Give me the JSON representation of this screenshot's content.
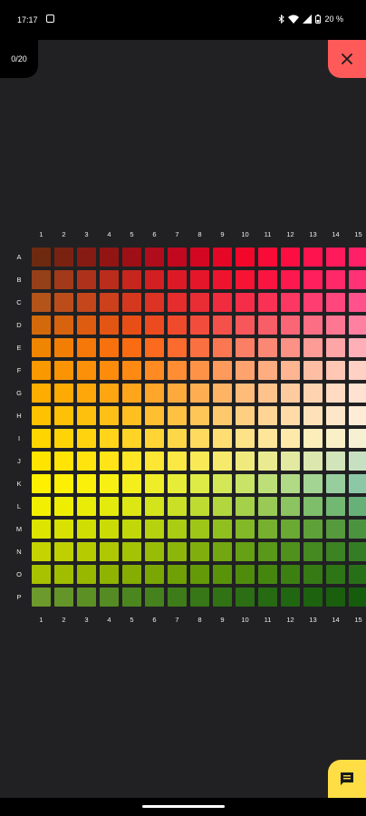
{
  "status_bar": {
    "time": "17:17",
    "battery_text": "20 %"
  },
  "counter": {
    "text": "0/20"
  },
  "icons": {
    "close": "close-icon",
    "chat": "chat-icon"
  },
  "colors": {
    "background": "#212123",
    "close_button": "#ff5a5a",
    "chat_button": "#ffdd44"
  },
  "grid": {
    "column_labels": [
      "1",
      "2",
      "3",
      "4",
      "5",
      "6",
      "7",
      "8",
      "9",
      "10",
      "11",
      "12",
      "13",
      "14",
      "15"
    ],
    "row_labels": [
      "A",
      "B",
      "C",
      "D",
      "E",
      "F",
      "G",
      "H",
      "I",
      "J",
      "K",
      "L",
      "M",
      "N",
      "O",
      "P"
    ],
    "rows": [
      [
        "#6e2a10",
        "#7a2212",
        "#861b13",
        "#921514",
        "#9e1016",
        "#b00c1c",
        "#c2081f",
        "#d40723",
        "#e60626",
        "#f2072b",
        "#f80b36",
        "#fc0e42",
        "#ff134f",
        "#ff1a5c",
        "#ff2068"
      ],
      [
        "#964019",
        "#a2391a",
        "#ae321b",
        "#ba2c1c",
        "#c6261e",
        "#d21f22",
        "#dc1a26",
        "#e6162a",
        "#ef142e",
        "#f61334",
        "#fa1540",
        "#fd184d",
        "#ff1f5b",
        "#ff2868",
        "#ff3276"
      ],
      [
        "#b4541a",
        "#bc4d1a",
        "#c4461a",
        "#cc401c",
        "#d4391f",
        "#dc3325",
        "#e42d2c",
        "#ea2c35",
        "#f02c3e",
        "#f52d49",
        "#f93155",
        "#fc3762",
        "#ff3e6f",
        "#ff477d",
        "#ff518b"
      ],
      [
        "#d26a0c",
        "#d8630e",
        "#de5c10",
        "#e35513",
        "#e84f17",
        "#ec4b20",
        "#f04a2d",
        "#f24d3c",
        "#f4514b",
        "#f6575a",
        "#f85e68",
        "#fa6676",
        "#fc6e84",
        "#fe7792",
        "#ff80a0"
      ],
      [
        "#ef8500",
        "#f27f04",
        "#f57808",
        "#f8710c",
        "#fa6c12",
        "#fb6a1e",
        "#fb6b2e",
        "#fb7040",
        "#fb7752",
        "#fb7f64",
        "#fb8875",
        "#fc9186",
        "#fd9b97",
        "#fea5a8",
        "#ffafb8"
      ],
      [
        "#fa9800",
        "#fb9404",
        "#fc9008",
        "#fd8c0d",
        "#fe8a14",
        "#fe8a22",
        "#fe8d34",
        "#fe9347",
        "#fe9a5b",
        "#fea36e",
        "#feac80",
        "#feb592",
        "#febea3",
        "#ffc7b4",
        "#ffd0c4"
      ],
      [
        "#fdad00",
        "#fdaa05",
        "#fea70b",
        "#fea512",
        "#fea51c",
        "#fea62a",
        "#fea93c",
        "#feae50",
        "#feb465",
        "#febb79",
        "#fec38c",
        "#fecb9e",
        "#fed3b0",
        "#fedbc1",
        "#ffe2d1"
      ],
      [
        "#fec200",
        "#fec106",
        "#fec00d",
        "#febf16",
        "#febf21",
        "#febf30",
        "#fec142",
        "#fec557",
        "#fec96c",
        "#fecf81",
        "#fed595",
        "#fedba7",
        "#fee1b8",
        "#fee7c8",
        "#ffecd6"
      ],
      [
        "#ffd500",
        "#ffd407",
        "#ffd40f",
        "#ffd41a",
        "#ffd427",
        "#ffd536",
        "#fed749",
        "#feda5e",
        "#fede73",
        "#fee287",
        "#fde69a",
        "#fdeaab",
        "#fceebb",
        "#f9f0c8",
        "#f5f1d2"
      ],
      [
        "#ffe400",
        "#ffe406",
        "#ffe40d",
        "#ffe418",
        "#fee525",
        "#fde634",
        "#fce845",
        "#f9e957",
        "#f5ea6b",
        "#f0ea7e",
        "#eaea90",
        "#e3e9a0",
        "#dbe7ae",
        "#d2e4b9",
        "#c8e0c2"
      ],
      [
        "#fff000",
        "#fdf004",
        "#fbf00a",
        "#f8f012",
        "#f4ef1c",
        "#eeee28",
        "#e7ec36",
        "#deea46",
        "#d4e756",
        "#c9e367",
        "#bddf77",
        "#b1da86",
        "#a4d493",
        "#98ce9e",
        "#8cc8a6"
      ],
      [
        "#f2f000",
        "#eeee02",
        "#e9ec06",
        "#e3ea0c",
        "#dce713",
        "#d3e41c",
        "#c9e026",
        "#bedb31",
        "#b2d63d",
        "#a5d049",
        "#98ca55",
        "#8bc460",
        "#7ebd6a",
        "#72b772",
        "#67b078"
      ],
      [
        "#dde400",
        "#d8e101",
        "#d1de03",
        "#cadb06",
        "#c1d70a",
        "#b6d20e",
        "#aacc13",
        "#9dc619",
        "#90bf20",
        "#83b827",
        "#76b02e",
        "#6aa934",
        "#5fa139",
        "#559a3d",
        "#4c9340"
      ],
      [
        "#c5d400",
        "#bed000",
        "#b6cc01",
        "#aec803",
        "#a4c305",
        "#99bd07",
        "#8db60a",
        "#80af0d",
        "#73a711",
        "#66a015",
        "#5a9819",
        "#4f911d",
        "#458a20",
        "#3c8323",
        "#357d25"
      ],
      [
        "#a9c200",
        "#a1bd00",
        "#98b800",
        "#8fb301",
        "#85ad02",
        "#7aa704",
        "#6fa005",
        "#649a07",
        "#59930a",
        "#4f8c0c",
        "#45860f",
        "#3c8011",
        "#357a14",
        "#2e7516",
        "#287018"
      ],
      [
        "#6c9a2c",
        "#649528",
        "#5c9025",
        "#548b22",
        "#4c861f",
        "#45811c",
        "#3e7c1a",
        "#377717",
        "#317215",
        "#2b6e13",
        "#266a12",
        "#216610",
        "#1d620f",
        "#195f0e",
        "#165c0d"
      ]
    ]
  }
}
